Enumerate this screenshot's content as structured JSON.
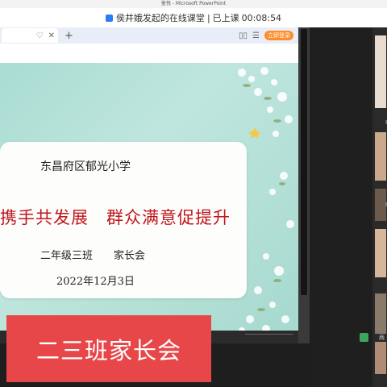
{
  "window": {
    "title": "鉴悦 - Microsoft PowerPoint"
  },
  "classroom": {
    "title": "侯井娥发起的在线课堂",
    "status": "已上课",
    "timer": "00:08:54"
  },
  "browser_tab": {
    "new_tab": "+",
    "badge": "立即登录"
  },
  "slide": {
    "school": "东昌府区郁光小学",
    "slogan": "携手共发展　群众满意促提升",
    "meeting": "二年级三班　　家长会",
    "date": "2022年12月3日"
  },
  "banner": {
    "text": "二三班家长会"
  },
  "participants": [
    {
      "label": "I"
    },
    {
      "label": "C"
    },
    {
      "label": "两"
    }
  ],
  "colors": {
    "slide_bg": "#a9dcd2",
    "slogan_red": "#c0151b",
    "banner_red": "#e8474a"
  }
}
